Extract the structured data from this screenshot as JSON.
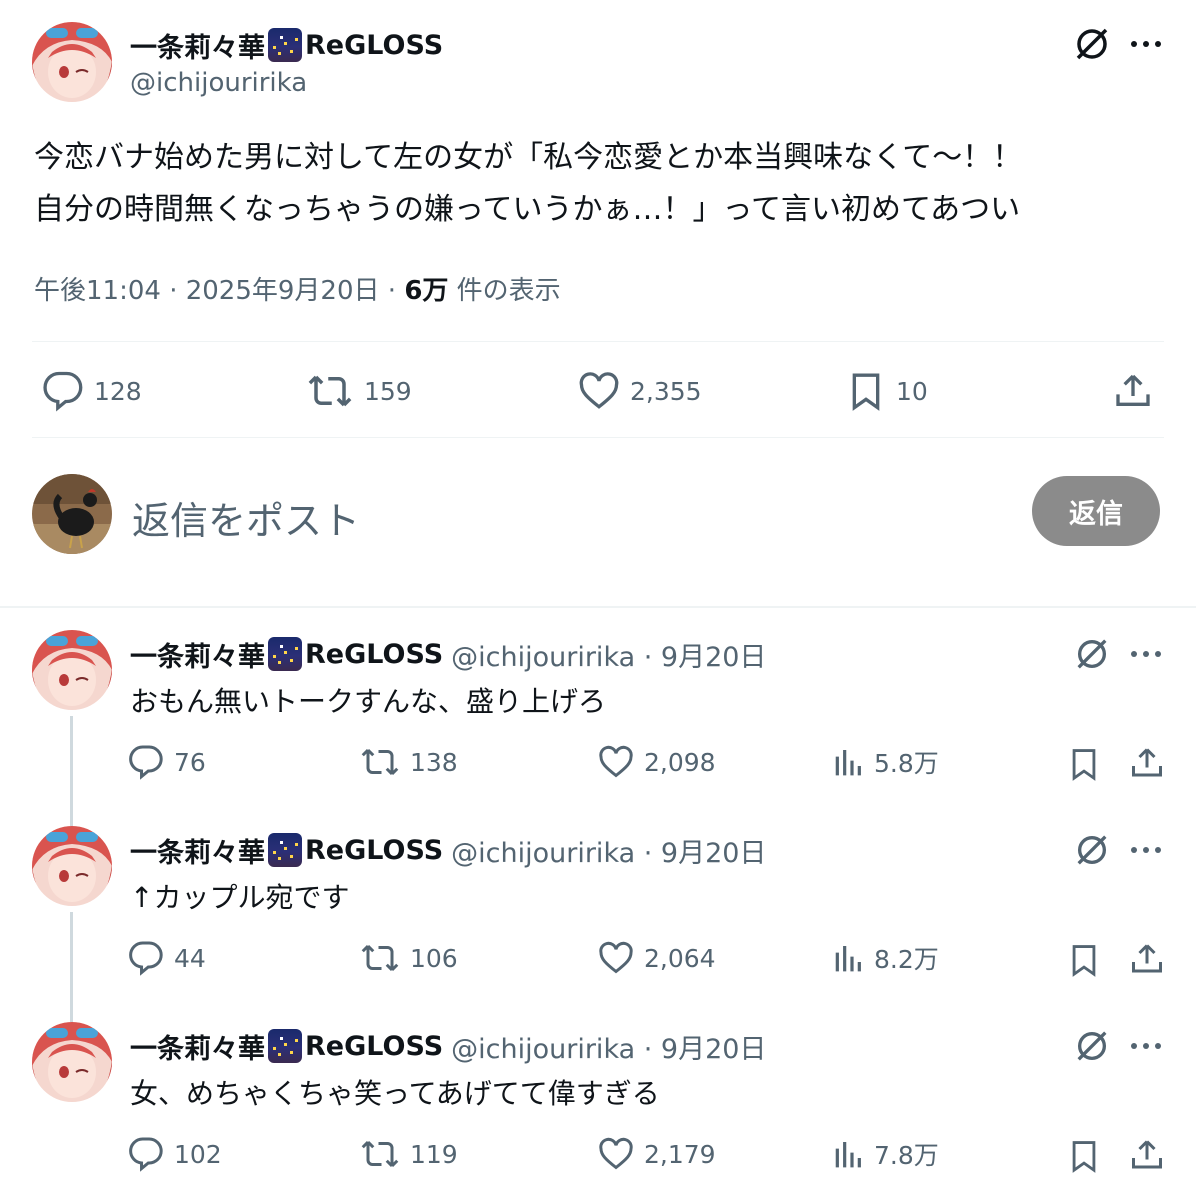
{
  "colors": {
    "text": "#0f1419",
    "muted": "#536471",
    "divider": "#eff3f4",
    "reply_button": "#8b8b8b",
    "thread_line": "#cfd9de"
  },
  "main_post": {
    "author_name": "一条莉々華",
    "author_suffix": "ReGLOSS",
    "badge_icon": "night-city-emoji-icon",
    "handle": "@ichijouririka",
    "text_line1": "今恋バナ始めた男に対して左の女が「私今恋愛とか本当興味なくて〜！！",
    "text_line2": "自分の時間無くなっちゃうの嫌っていうかぁ…！」って言い初めてあつい",
    "time": "午後11:04 · 2025年9月20日 · ",
    "views_count": "6万",
    "views_label": " 件の表示",
    "stats": {
      "replies": "128",
      "reposts": "159",
      "likes": "2,355",
      "bookmarks": "10"
    }
  },
  "reply_box": {
    "placeholder": "返信をポスト",
    "button_label": "返信"
  },
  "replies": [
    {
      "author_name": "一条莉々華",
      "author_suffix": "ReGLOSS",
      "handle": "@ichijouririka · 9月20日",
      "text": "おもん無いトークすんな、盛り上げろ",
      "replies": "76",
      "reposts": "138",
      "likes": "2,098",
      "views": "5.8万"
    },
    {
      "author_name": "一条莉々華",
      "author_suffix": "ReGLOSS",
      "handle": "@ichijouririka · 9月20日",
      "text": "↑カップル宛です",
      "replies": "44",
      "reposts": "106",
      "likes": "2,064",
      "views": "8.2万"
    },
    {
      "author_name": "一条莉々華",
      "author_suffix": "ReGLOSS",
      "handle": "@ichijouririka · 9月20日",
      "text": "女、めちゃくちゃ笑ってあげてて偉すぎる",
      "replies": "102",
      "reposts": "119",
      "likes": "2,179",
      "views": "7.8万"
    }
  ]
}
